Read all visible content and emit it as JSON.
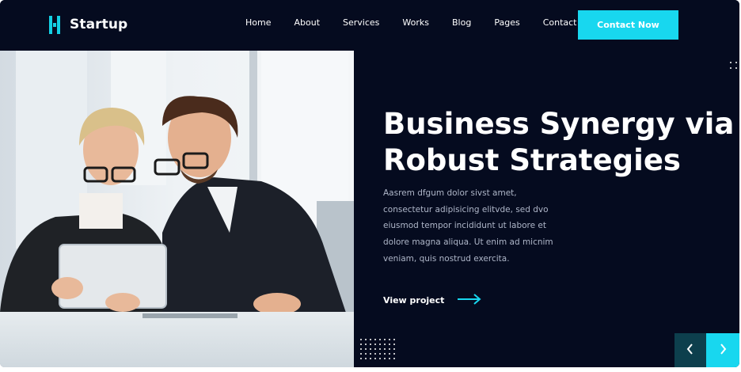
{
  "brand": {
    "name": "Startup",
    "accent": "#18d7ef",
    "background": "#050b1f"
  },
  "nav": {
    "items": [
      {
        "label": "Home"
      },
      {
        "label": "About"
      },
      {
        "label": "Services"
      },
      {
        "label": "Works"
      },
      {
        "label": "Blog"
      },
      {
        "label": "Pages"
      },
      {
        "label": "Contact"
      }
    ],
    "cta_label": "Contact Now"
  },
  "hero": {
    "title_line1": "Business Synergy via",
    "title_line2": "Robust Strategies",
    "description": "Aasrem dfgum dolor sivst amet, consectetur adipisicing elitvde, sed dvo eiusmod tempor incididunt ut labore et dolore magna aliqua. Ut enim ad micnim veniam, quis nostrud exercita.",
    "link_label": "View project",
    "image": "business-team-photo"
  },
  "slider": {
    "prev_icon": "chevron-left-icon",
    "next_icon": "chevron-right-icon"
  }
}
